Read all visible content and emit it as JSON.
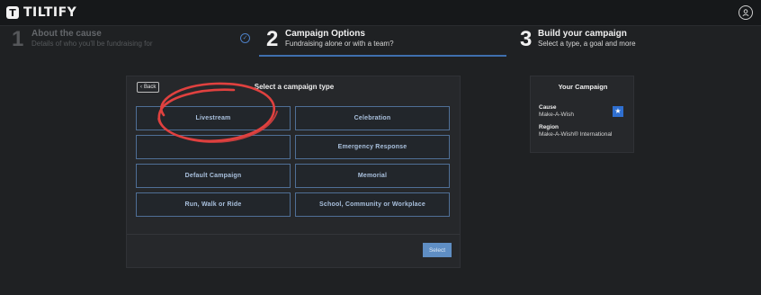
{
  "header": {
    "logo_mark": "T",
    "logo_text": "TILTIFY",
    "avatar_icon": "user-circle-icon"
  },
  "steps": [
    {
      "number": "1",
      "title": "About the cause",
      "subtitle": "Details of who you'll be fundraising for",
      "status": "complete",
      "check_icon": "check-circle-icon"
    },
    {
      "number": "2",
      "title": "Campaign Options",
      "subtitle": "Fundraising alone or with a team?",
      "status": "active"
    },
    {
      "number": "3",
      "title": "Build your campaign",
      "subtitle": "Select a type, a goal and more",
      "status": "upcoming"
    }
  ],
  "panel": {
    "back_label": "Back",
    "title": "Select a campaign type",
    "options": [
      "Livestream",
      "Celebration",
      "",
      "Emergency Response",
      "Default Campaign",
      "Memorial",
      "Run, Walk or Ride",
      "School, Community or Workplace"
    ],
    "select_label": "Select"
  },
  "sidebar": {
    "title": "Your Campaign",
    "cause_label": "Cause",
    "cause_value": "Make-A-Wish",
    "region_label": "Region",
    "region_value": "Make-A-Wish® International",
    "badge_icon": "star-icon"
  },
  "annotation": {
    "shape": "red-hand-drawn-circle",
    "color": "#e0413f"
  },
  "colors": {
    "accent": "#3f6fae",
    "option_border": "#4f6f96",
    "button": "#5f8ec4"
  }
}
